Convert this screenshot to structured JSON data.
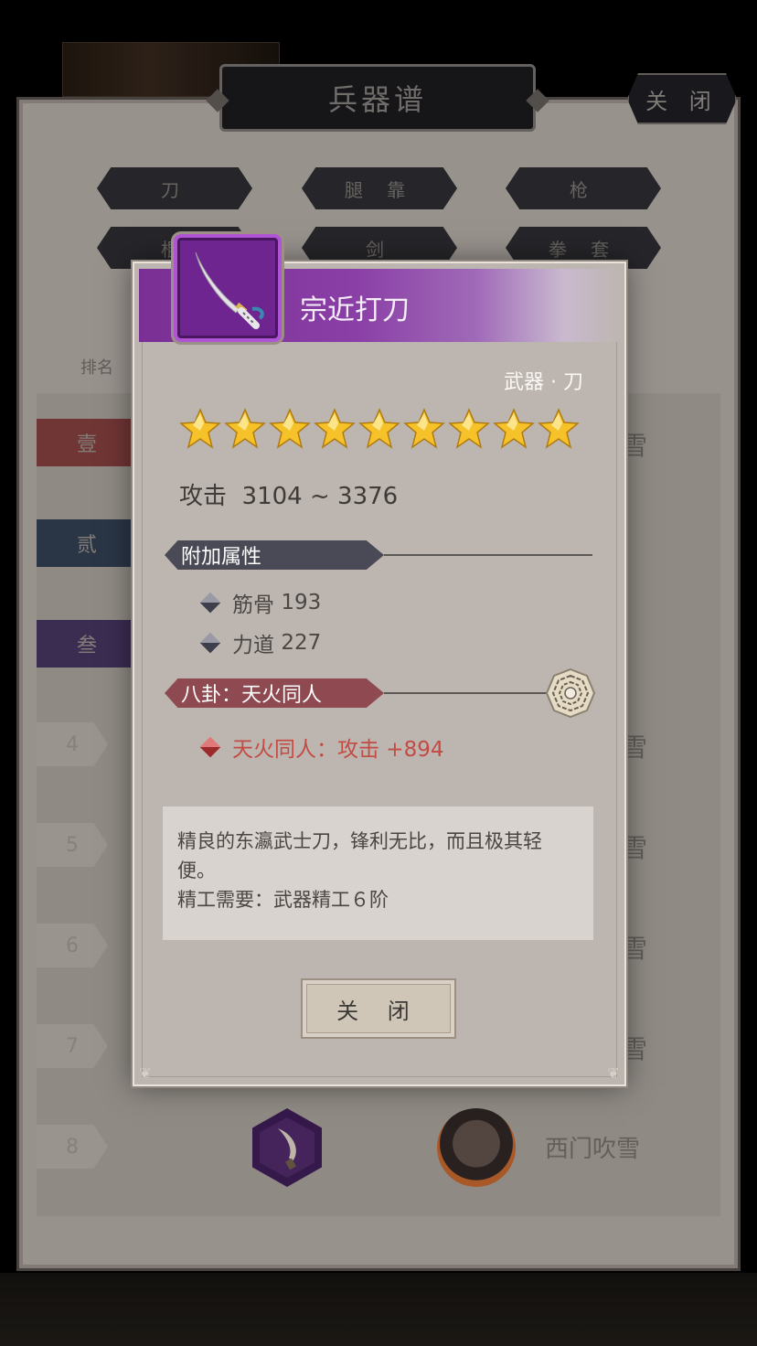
{
  "background": {
    "title": "兵器谱",
    "close_label": "关 闭",
    "category_tabs": [
      "刀",
      "腿 靠",
      "枪",
      "棍",
      "剑",
      "拳 套"
    ],
    "rank_header": "排名",
    "rank_badges": [
      "壹",
      "贰",
      "叁"
    ],
    "rank_numbers": [
      "4",
      "5",
      "6",
      "7",
      "8"
    ],
    "list_name_fragment": "雪",
    "row8_player_name": "西门吹雪"
  },
  "dialog": {
    "item_name": "宗近打刀",
    "item_type": "武器 · 刀",
    "star_count": 9,
    "attack_label": "攻击",
    "attack_value": "3104 ~ 3376",
    "extra_section_title": "附加属性",
    "extra_attributes": [
      {
        "name": "筋骨",
        "value": "193"
      },
      {
        "name": "力道",
        "value": "227"
      }
    ],
    "bagua_section_title": "八卦：天火同人",
    "bagua_bonus": "天火同人：攻击 +894",
    "description_line1": "精良的东瀛武士刀，锋利无比，而且极其轻便。",
    "description_line2": "精工需要：武器精工６阶",
    "close_button_label": "关 闭"
  },
  "colors": {
    "rarity_purple": "#7a2f94",
    "star_gold": "#f5c22a",
    "bonus_red": "#c44a44"
  },
  "icons": {
    "item_icon": "katana-icon",
    "bagua_icon": "bagua-icon",
    "star_icon": "star-icon"
  }
}
